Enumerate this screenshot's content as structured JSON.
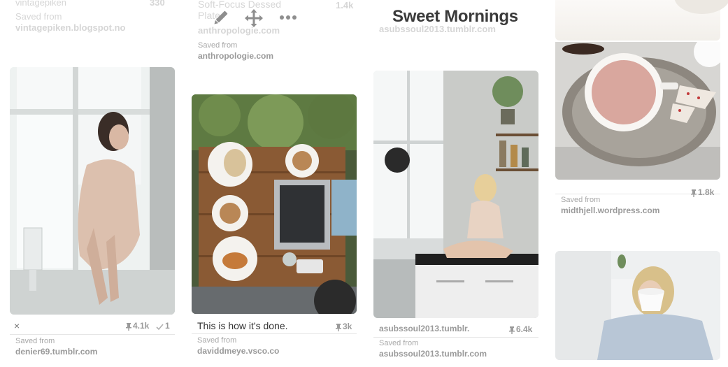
{
  "board": {
    "title": "Sweet Mornings"
  },
  "header": {
    "overlay": {
      "col1_line1": "vintagepiken",
      "col1_stat": "330",
      "col1_line2": "Saved from",
      "col1_line3": "vintagepiken.blogspot.no",
      "col2_line1": "Soft-Focus Dessed",
      "col2_line2": "Plate",
      "col2_stat": "1.4k",
      "col2_line3": "anthropologie.com",
      "col3_line1": "asubssoul2013.tumblr.com"
    }
  },
  "pins": [
    {
      "id": "pin1",
      "image": "woman-by-window",
      "close_glyph": "×",
      "repins": "4.1k",
      "likes": "1",
      "saved_label": "Saved from",
      "source": "denier69.tumblr.com"
    },
    {
      "id": "pin_top2",
      "saved_label": "Saved from",
      "source": "anthropologie.com"
    },
    {
      "id": "pin2",
      "image": "coffee-laptop-table",
      "description": "This is how it's done.",
      "repins": "3k",
      "saved_label": "Saved from",
      "source": "daviddmeye.vsco.co"
    },
    {
      "id": "pin3",
      "image": "kitchen-counter",
      "title_source": "asubssoul2013.tumblr.",
      "repins": "6.4k",
      "saved_label": "Saved from",
      "source": "asubssoul2013.tumblr.com"
    },
    {
      "id": "pin4",
      "image": "pink-latte-wood",
      "repins": "1.8k",
      "saved_label": "Saved from",
      "source": "midthjell.wordpress.com"
    },
    {
      "id": "pin5",
      "image": "woman-drinking-cup"
    }
  ],
  "colors": {
    "accent": "#cb2027",
    "muted_text": "#9a9a9a",
    "title": "#3a3a3a"
  },
  "icons": [
    "pencil-icon",
    "move-icon",
    "more-icon",
    "pin-icon",
    "check-icon"
  ]
}
